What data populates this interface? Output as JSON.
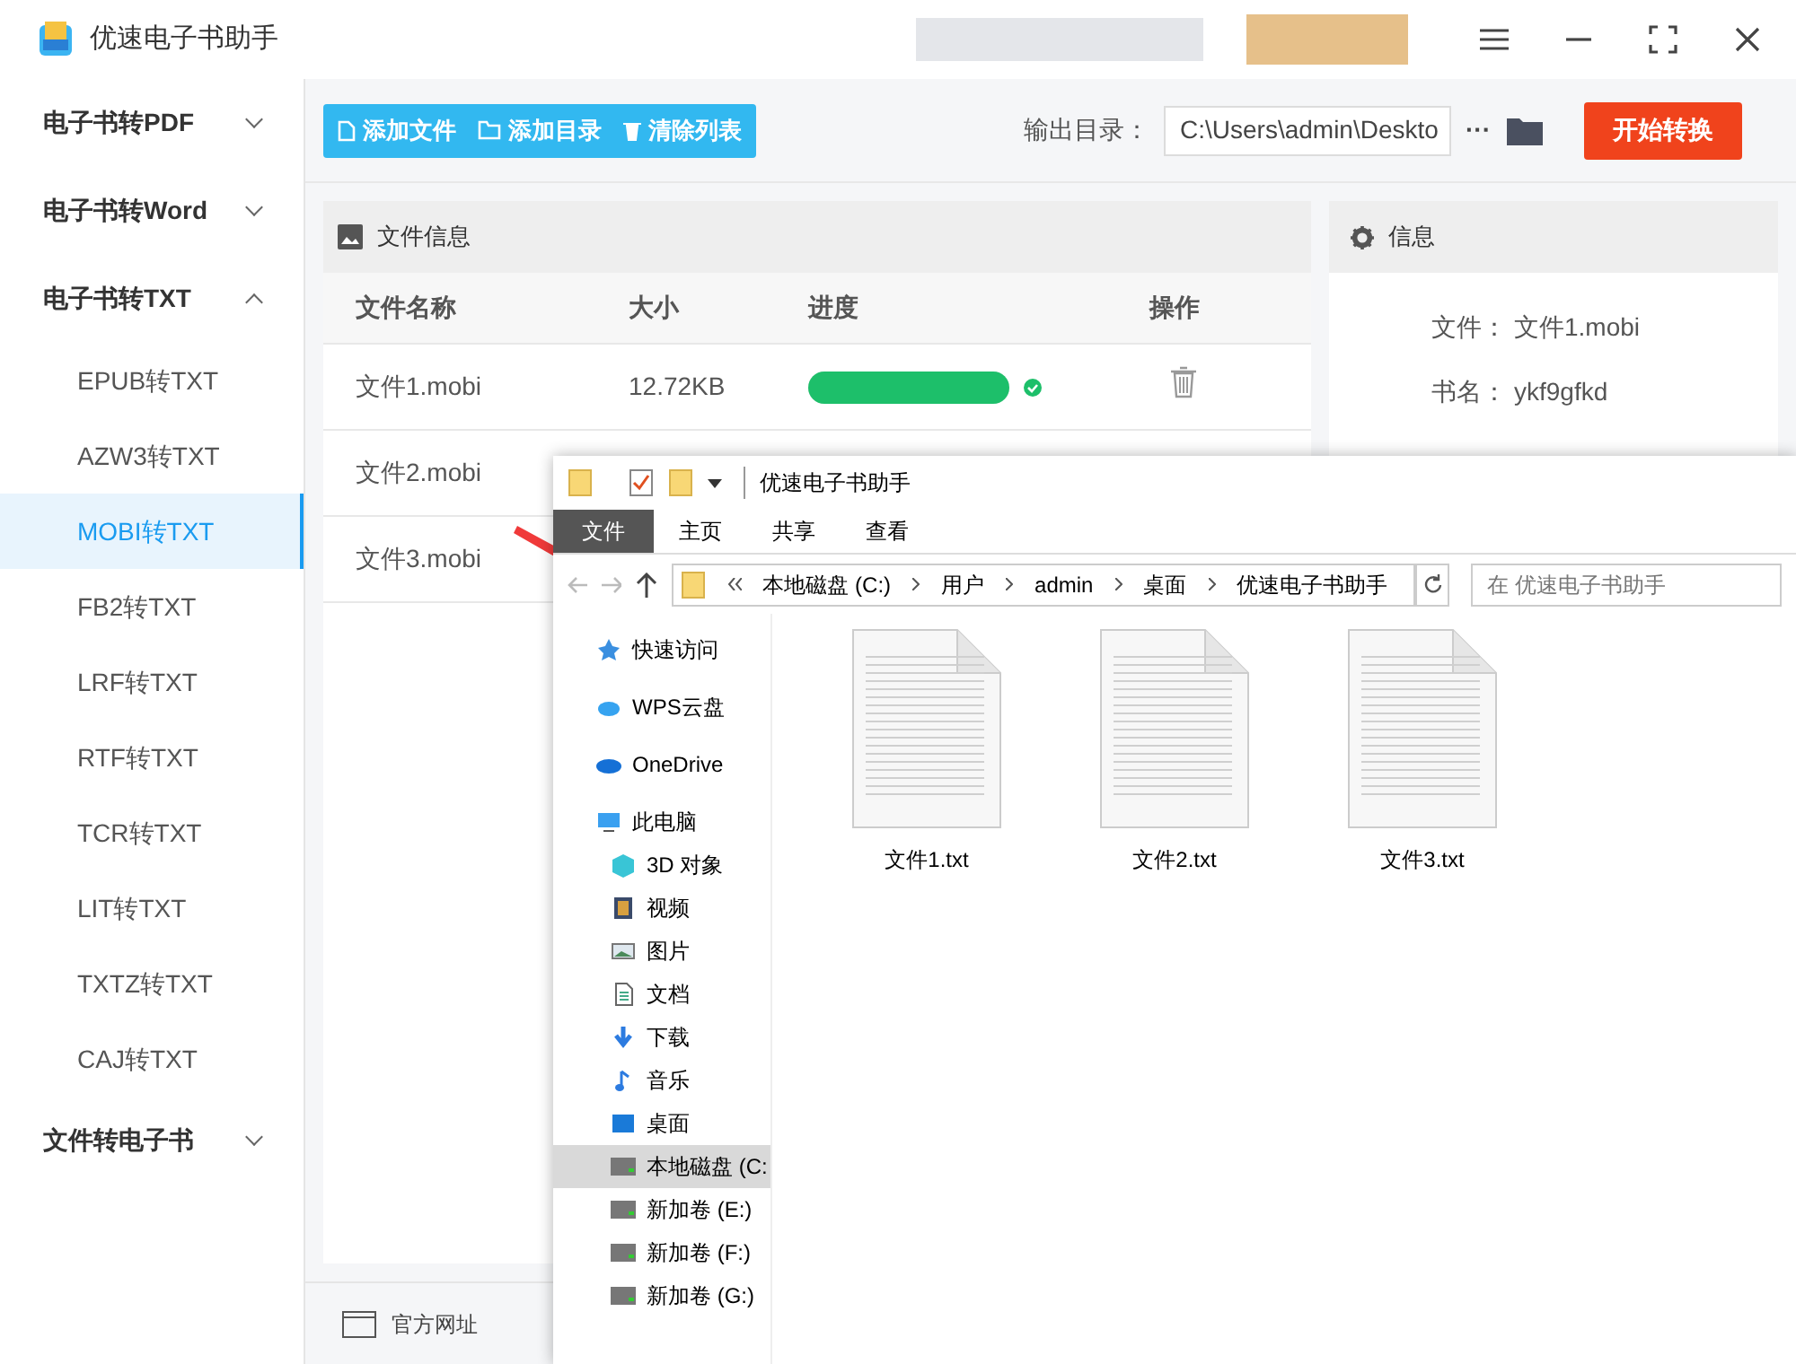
{
  "window": {
    "title": "优速电子书助手"
  },
  "sidebar": {
    "items": [
      {
        "label": "电子书转PDF",
        "expanded": false
      },
      {
        "label": "电子书转Word",
        "expanded": false
      },
      {
        "label": "电子书转TXT",
        "expanded": true,
        "children": [
          {
            "label": "EPUB转TXT",
            "selected": false
          },
          {
            "label": "AZW3转TXT",
            "selected": false
          },
          {
            "label": "MOBI转TXT",
            "selected": true
          },
          {
            "label": "FB2转TXT",
            "selected": false
          },
          {
            "label": "LRF转TXT",
            "selected": false
          },
          {
            "label": "RTF转TXT",
            "selected": false
          },
          {
            "label": "TCR转TXT",
            "selected": false
          },
          {
            "label": "LIT转TXT",
            "selected": false
          },
          {
            "label": "TXTZ转TXT",
            "selected": false
          },
          {
            "label": "CAJ转TXT",
            "selected": false
          }
        ]
      },
      {
        "label": "文件转电子书",
        "expanded": false
      }
    ]
  },
  "toolbar": {
    "buttons": [
      "添加文件",
      "添加目录",
      "清除列表"
    ],
    "output_label": "输出目录：",
    "output_path": "C:\\Users\\admin\\Deskto",
    "more": "···",
    "start": "开始转换"
  },
  "file_panel": {
    "title": "文件信息",
    "columns": [
      "文件名称",
      "大小",
      "进度",
      "操作"
    ],
    "rows": [
      {
        "name": "文件1.mobi",
        "size": "12.72KB",
        "level": 1,
        "done": true
      },
      {
        "name": "文件2.mobi"
      },
      {
        "name": "文件3.mobi"
      }
    ]
  },
  "info_panel": {
    "title": "信息",
    "fields": [
      {
        "label": "文件：",
        "value": "文件1.mobi"
      },
      {
        "label": "书名：",
        "value": "ykf9gfkd"
      }
    ]
  },
  "footer": {
    "links": [
      "官方网址"
    ]
  },
  "explorer": {
    "title": "优速电子书助手",
    "tabs": [
      {
        "label": "文件",
        "selected": true
      },
      {
        "label": "主页",
        "selected": false
      },
      {
        "label": "共享",
        "selected": false
      },
      {
        "label": "查看",
        "selected": false
      }
    ],
    "path": [
      "本地磁盘 (C:)",
      "用户",
      "admin",
      "桌面",
      "优速电子书助手"
    ],
    "search_placeholder": "在 优速电子书助手",
    "nav": [
      {
        "label": "快速访问",
        "kind": "star",
        "selected": false
      },
      {
        "label": "WPS云盘",
        "kind": "cloud",
        "selected": false
      },
      {
        "label": "OneDrive",
        "kind": "onedrive",
        "selected": false
      },
      {
        "label": "此电脑",
        "kind": "pc",
        "selected": false,
        "children": [
          {
            "label": "3D 对象",
            "kind": "cube",
            "selected": false
          },
          {
            "label": "视频",
            "kind": "film",
            "selected": false
          },
          {
            "label": "图片",
            "kind": "picture",
            "selected": false
          },
          {
            "label": "文档",
            "kind": "doc",
            "selected": false
          },
          {
            "label": "下载",
            "kind": "download",
            "selected": false
          },
          {
            "label": "音乐",
            "kind": "music",
            "selected": false
          },
          {
            "label": "桌面",
            "kind": "desktop",
            "selected": false
          },
          {
            "label": "本地磁盘 (C:",
            "kind": "drive",
            "selected": true
          },
          {
            "label": "新加卷 (E:)",
            "kind": "drive",
            "selected": false
          },
          {
            "label": "新加卷 (F:)",
            "kind": "drive",
            "selected": false
          },
          {
            "label": "新加卷 (G:)",
            "kind": "drive",
            "selected": false
          }
        ]
      }
    ],
    "files": [
      "文件1.txt",
      "文件2.txt",
      "文件3.txt"
    ]
  }
}
